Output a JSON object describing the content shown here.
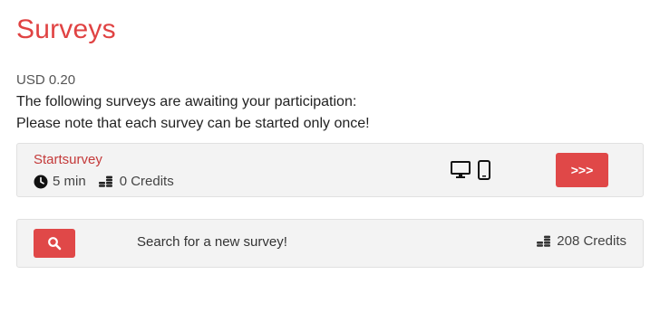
{
  "page": {
    "title": "Surveys",
    "balance": "USD 0.20",
    "note_line1": "The following surveys are awaiting your participation:",
    "note_line2": "Please note that each survey can be started only once!"
  },
  "survey": {
    "title": "Startsurvey",
    "duration": "5 min",
    "credits": "0 Credits",
    "start_button_label": ">>>",
    "devices": [
      "desktop-icon",
      "mobile-icon"
    ]
  },
  "search": {
    "label": "Search for a new survey!",
    "credits": "208 Credits",
    "button_icon": "search-icon"
  },
  "colors": {
    "accent": "#e04848",
    "title": "#e04343",
    "card_bg": "#f3f3f3"
  }
}
